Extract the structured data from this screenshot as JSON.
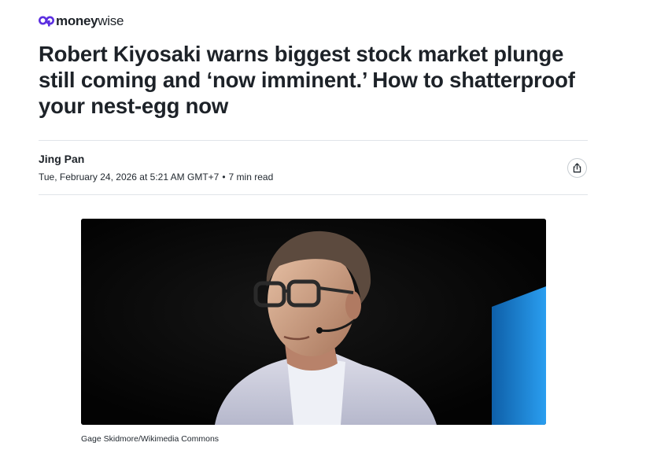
{
  "brand": {
    "name_bold": "money",
    "name_light": "wise",
    "accent_color": "#5b2ee0"
  },
  "article": {
    "headline": "Robert Kiyosaki warns biggest stock market plunge still coming and ‘now imminent.’ How to shatterproof your nest-egg now",
    "author": "Jing Pan",
    "date": "Tue, February 24, 2026 at 5:21 AM GMT+7",
    "separator": "•",
    "read_time": "7 min read",
    "share_icon": "share-icon"
  },
  "hero_image": {
    "caption": "Gage Skidmore/Wikimedia Commons",
    "background_color": "#060606",
    "accent_light_color": "#1f8fe0"
  }
}
